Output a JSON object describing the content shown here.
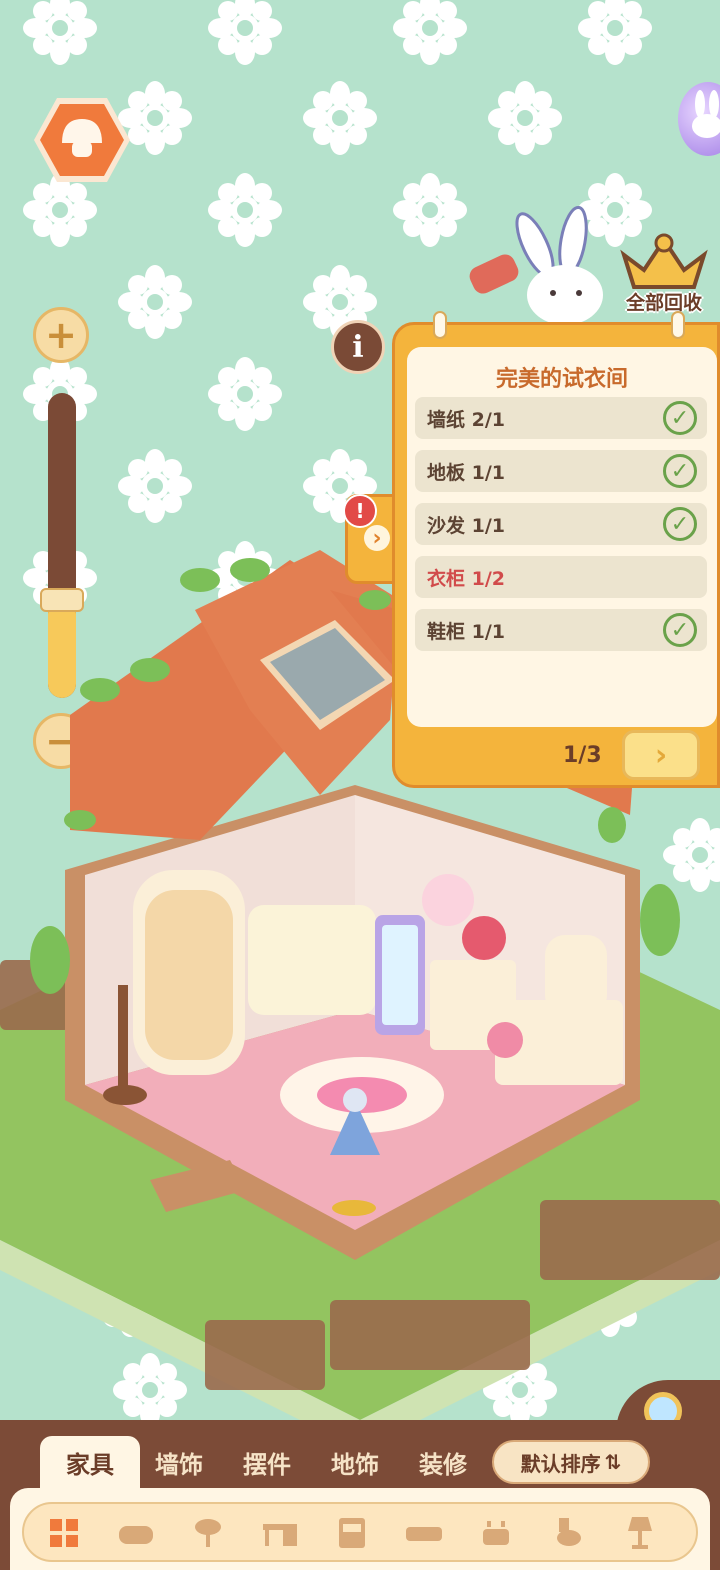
{
  "colors": {
    "background": "#b5e2cc",
    "panel_orange": "#f4b43c",
    "complete_green": "#6aa24a",
    "incomplete_red": "#d14b4b",
    "wood_brown": "#7c4b37"
  },
  "icons": {
    "home": "mushroom-home-icon",
    "info": "info-icon",
    "recycle": "crown-recycle-icon",
    "search": "magnifier-icon",
    "zoom_in": "plus-icon",
    "zoom_out": "minus-icon",
    "sort": "sort-icon"
  },
  "zoom": {
    "plus_label": "+",
    "minus_label": "−",
    "level": 0.32
  },
  "info_label": "i",
  "recycle": {
    "label": "全部回收"
  },
  "task_panel": {
    "title": "完美的试衣间",
    "alert": "!",
    "tab_arrow": "›",
    "requirements": [
      {
        "label": "墙纸 2/1",
        "complete": true
      },
      {
        "label": "地板 1/1",
        "complete": true
      },
      {
        "label": "沙发 1/1",
        "complete": true
      },
      {
        "label": "衣柜 1/2",
        "complete": false
      },
      {
        "label": "鞋柜 1/1",
        "complete": true
      }
    ],
    "check_glyph": "✓",
    "page_indicator": "1/3",
    "next_glyph": "›"
  },
  "tabs": [
    {
      "label": "家具",
      "active": true
    },
    {
      "label": "墙饰",
      "active": false
    },
    {
      "label": "摆件",
      "active": false
    },
    {
      "label": "地饰",
      "active": false
    },
    {
      "label": "装修",
      "active": false
    }
  ],
  "sort": {
    "label": "默认排序",
    "icon_glyph": "⇅"
  },
  "categories": [
    {
      "name": "all-grid-icon",
      "active": true
    },
    {
      "name": "armchair-icon",
      "active": false
    },
    {
      "name": "chair-icon",
      "active": false
    },
    {
      "name": "desk-icon",
      "active": false
    },
    {
      "name": "cabinet-icon",
      "active": false
    },
    {
      "name": "bed-icon",
      "active": false
    },
    {
      "name": "stove-icon",
      "active": false
    },
    {
      "name": "toilet-icon",
      "active": false
    },
    {
      "name": "lamp-icon",
      "active": false
    }
  ]
}
